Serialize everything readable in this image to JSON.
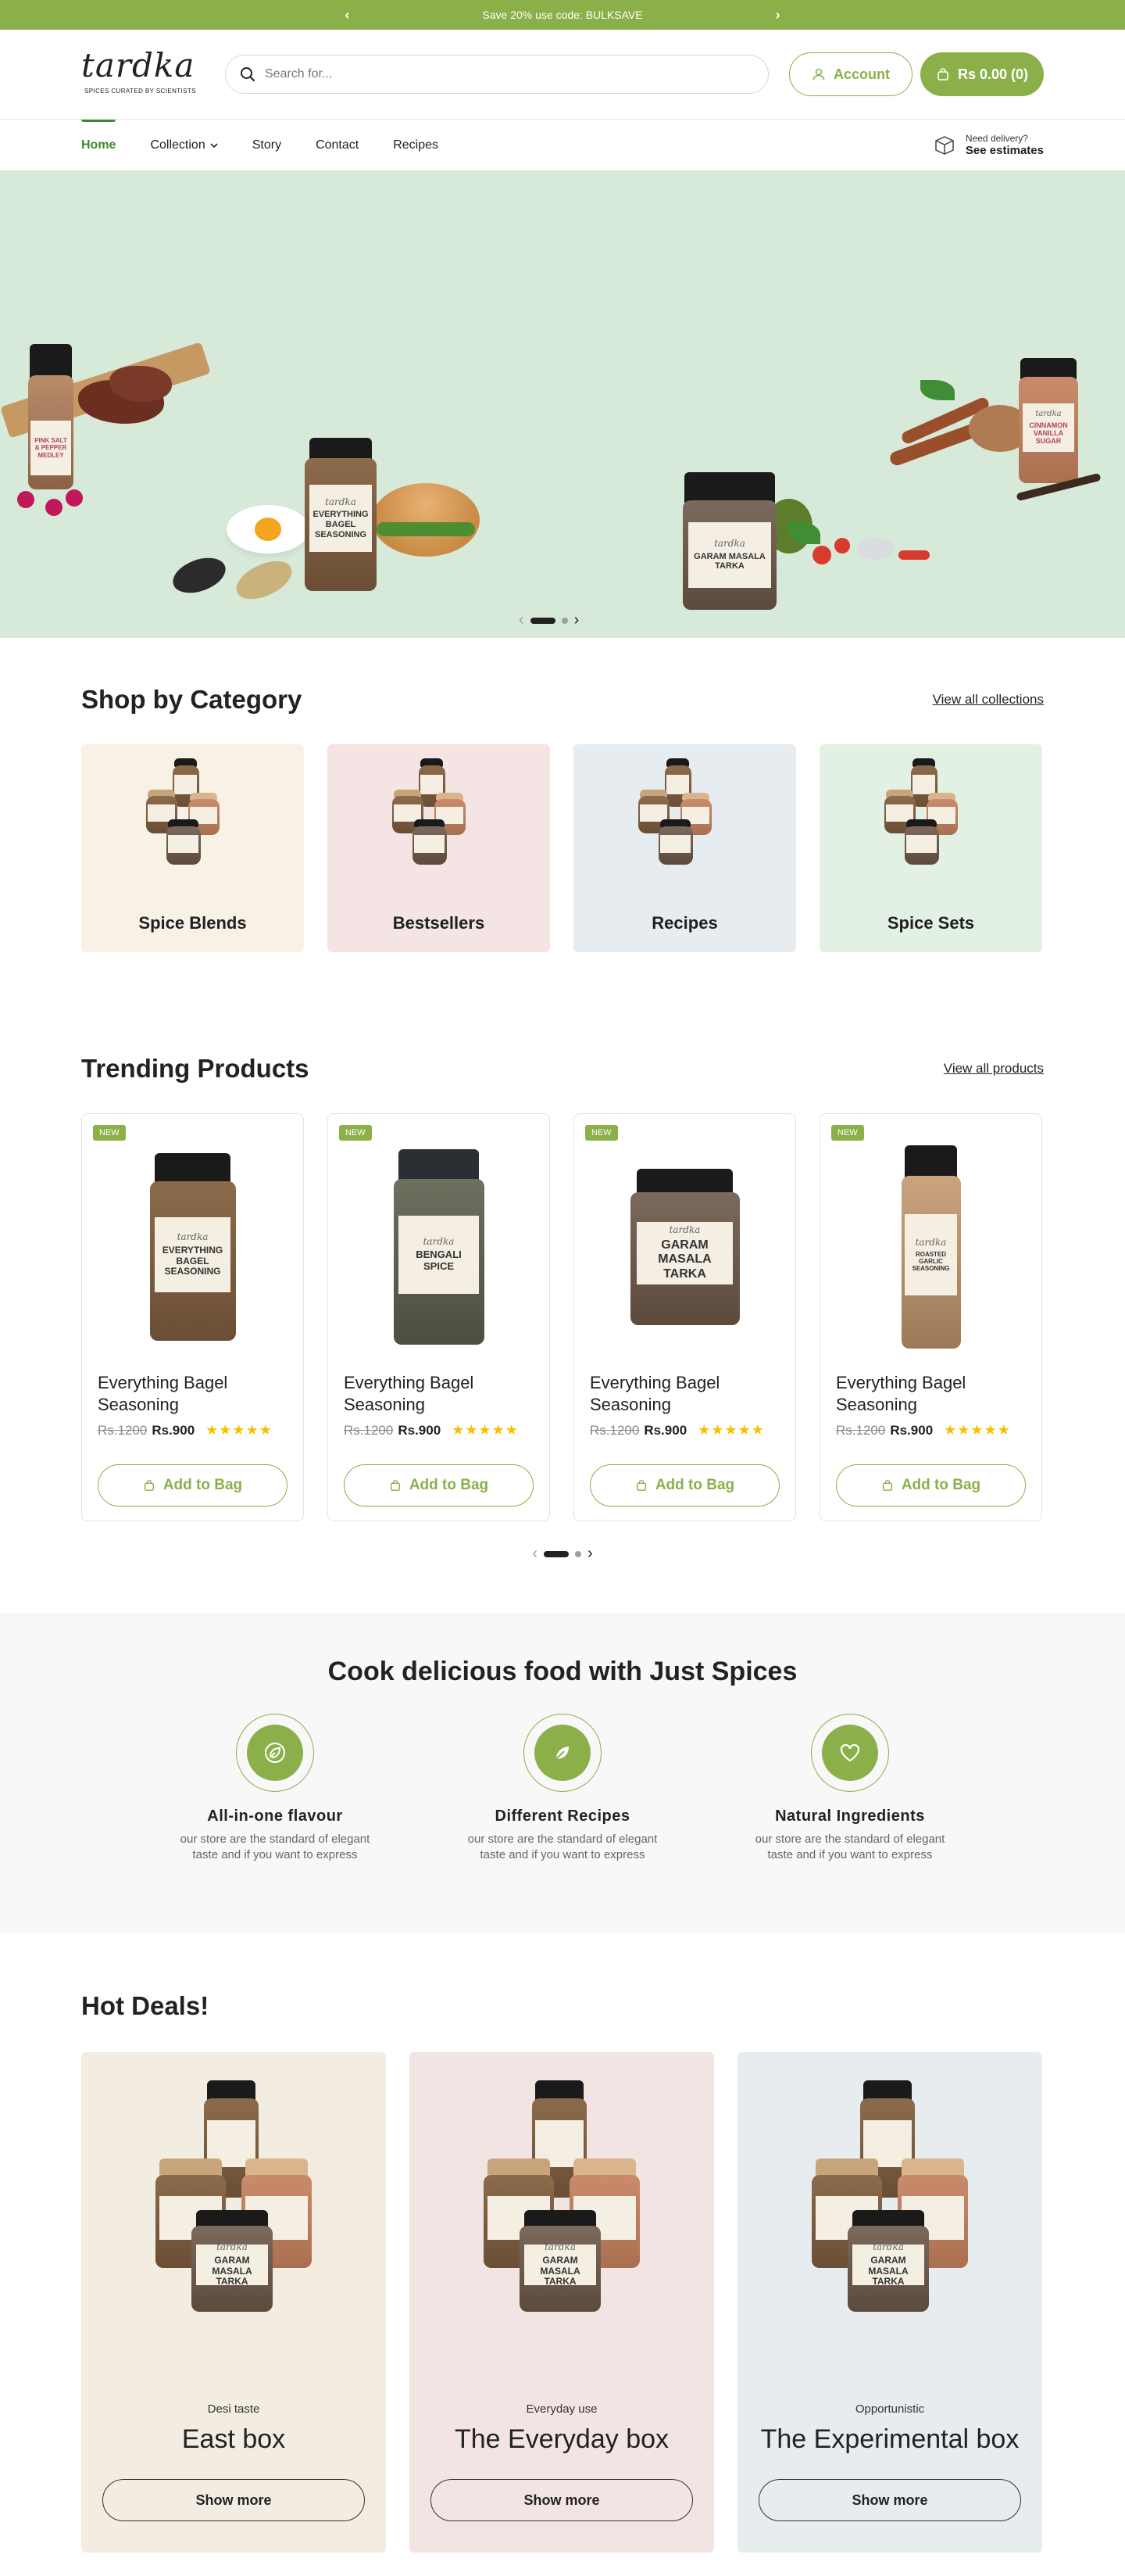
{
  "promo": {
    "text": "Save 20% use code: BULKSAVE"
  },
  "header": {
    "logo_word": "tardka",
    "logo_tagline": "SPICES CURATED BY SCIENTISTS",
    "search_placeholder": "Search for...",
    "account_label": "Account",
    "cart_label": "Rs 0.00 (0)"
  },
  "nav": {
    "items": [
      {
        "label": "Home"
      },
      {
        "label": "Collection"
      },
      {
        "label": "Story"
      },
      {
        "label": "Contact"
      },
      {
        "label": "Recipes"
      }
    ],
    "active_index": 0,
    "delivery_small": "Need delivery?",
    "delivery_big": "See estimates"
  },
  "hero": {
    "jars": [
      {
        "name": "PINK SALT & PEPPER MEDLEY"
      },
      {
        "name": "EVERYTHING BAGEL SEASONING"
      },
      {
        "name": "GARAM MASALA TARKA"
      },
      {
        "name": "CINNAMON VANILLA SUGAR"
      }
    ],
    "jar_brand": "tardka",
    "slide_count": 2,
    "active_slide": 0
  },
  "categories": {
    "title": "Shop by Category",
    "view_all": "View all collections",
    "items": [
      {
        "label": "Spice Blends",
        "bg": "#f7f1e6"
      },
      {
        "label": "Bestsellers",
        "bg": "#f4e4e4"
      },
      {
        "label": "Recipes",
        "bg": "#e6ecf0"
      },
      {
        "label": "Spice Sets",
        "bg": "#e2f1e3"
      }
    ]
  },
  "trending": {
    "title": "Trending Products",
    "view_all": "View all products",
    "products": [
      {
        "badge": "NEW",
        "name": "Everything Bagel Seasoning",
        "price_old": "Rs.1200",
        "price_new": "Rs.900",
        "rating": 5,
        "stars": "★★★★★",
        "add_label": "Add to Bag",
        "jar_text": "EVERYTHING BAGEL SEASONING"
      },
      {
        "badge": "NEW",
        "name": "Everything Bagel Seasoning",
        "price_old": "Rs.1200",
        "price_new": "Rs.900",
        "rating": 5,
        "stars": "★★★★★",
        "add_label": "Add to Bag",
        "jar_text": "BENGALI SPICE"
      },
      {
        "badge": "NEW",
        "name": "Everything Bagel Seasoning",
        "price_old": "Rs.1200",
        "price_new": "Rs.900",
        "rating": 5,
        "stars": "★★★★★",
        "add_label": "Add to Bag",
        "jar_text": "GARAM MASALA TARKA"
      },
      {
        "badge": "NEW",
        "name": "Everything Bagel Seasoning",
        "price_old": "Rs.1200",
        "price_new": "Rs.900",
        "rating": 5,
        "stars": "★★★★★",
        "add_label": "Add to Bag",
        "jar_text": "ROASTED GARLIC SEASONING"
      }
    ]
  },
  "features": {
    "title": "Cook delicious food with Just Spices",
    "items": [
      {
        "name": "All-in-one flavour",
        "desc": "our store are the standard of elegant taste and if you want to express",
        "icon": "leaf-icon"
      },
      {
        "name": "Different Recipes",
        "desc": "our store are the standard of elegant taste and if you want to express",
        "icon": "sprout-icon"
      },
      {
        "name": "Natural Ingredients",
        "desc": "our store are the standard of elegant taste and if you want to express",
        "icon": "heart-icon"
      }
    ]
  },
  "deals": {
    "title": "Hot Deals!",
    "items": [
      {
        "kicker": "Desi taste",
        "title": "East box",
        "button": "Show more",
        "bg": "#f3ede1"
      },
      {
        "kicker": "Everyday use",
        "title": "The Everyday box",
        "button": "Show more",
        "bg": "#f3e4e4"
      },
      {
        "kicker": "Opportunistic",
        "title": "The Experimental box",
        "button": "Show more",
        "bg": "#e7ecef"
      }
    ],
    "jar_front_text": "GARAM MASALA TARKA"
  },
  "colors": {
    "brand_green": "#8bb04a",
    "nav_active": "#3c8a2e",
    "hero_bg": "#d7ead9",
    "star": "#f2c200"
  }
}
